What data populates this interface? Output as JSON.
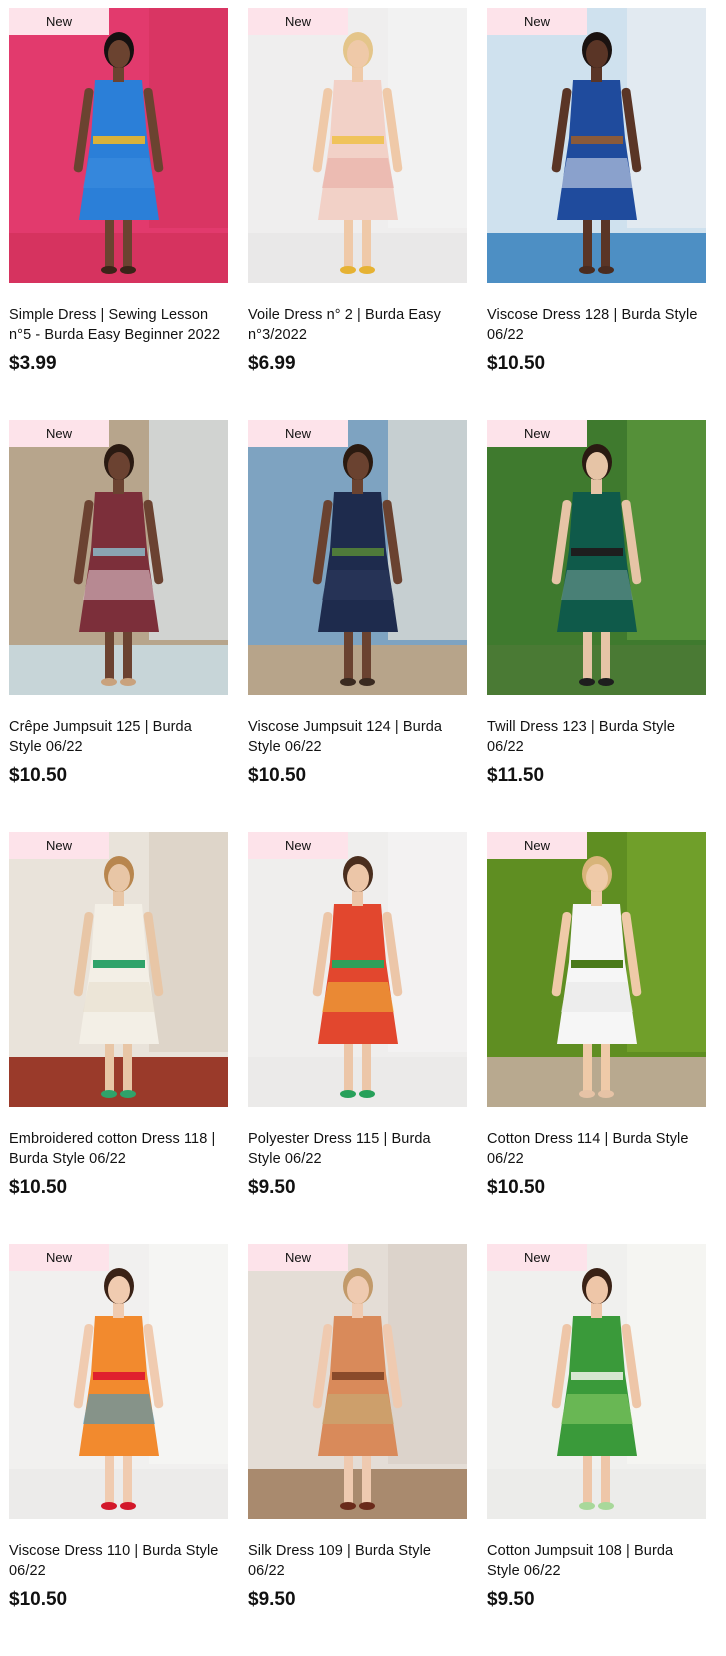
{
  "products": [
    {
      "badge": "New",
      "title": "Simple Dress | Sewing Lesson n°5 - Burda Easy Beginner 2022",
      "price": "$3.99",
      "scene": {
        "bg": "#e23a6d",
        "bg2": "#d6335f",
        "ground": "#d6335f",
        "dress": "#2b7fd8",
        "dress2": "#3e8ee0",
        "skin": "#6b4330",
        "hair": "#151010",
        "accent": "#d9b13a",
        "shoes": "#3a2418"
      }
    },
    {
      "badge": "New",
      "title": "Voile Dress n° 2 | Burda Easy n°3/2022",
      "price": "$6.99",
      "scene": {
        "bg": "#efeeee",
        "bg2": "#f4f3f3",
        "ground": "#e9e8e8",
        "dress": "#f2d1c7",
        "dress2": "#e7a9a1",
        "skin": "#efc9a8",
        "hair": "#e4c58a",
        "accent": "#f0c35b",
        "shoes": "#e6b233"
      }
    },
    {
      "badge": "New",
      "title": "Viscose Dress 128 | Burda Style 06/22",
      "price": "$10.50",
      "scene": {
        "bg": "#cfe1ee",
        "bg2": "#e9eef2",
        "ground": "#4d8fc4",
        "dress": "#1f4b9d",
        "dress2": "#e1e9f3",
        "skin": "#5a3526",
        "hair": "#1a1210",
        "accent": "#8a5a3a",
        "shoes": "#4a2c20"
      }
    },
    {
      "badge": "New",
      "title": "Crêpe Jumpsuit 125 | Burda Style 06/22",
      "price": "$10.50",
      "scene": {
        "bg": "#b7a58c",
        "bg2": "#dbe7ee",
        "ground": "#c7d5d8",
        "dress": "#7c2f3a",
        "dress2": "#e7d3da",
        "skin": "#6b4231",
        "hair": "#2a1a12",
        "accent": "#8aa4b2",
        "shoes": "#c9a27d"
      }
    },
    {
      "badge": "New",
      "title": "Viscose Jumpsuit 124 | Burda Style 06/22",
      "price": "$10.50",
      "scene": {
        "bg": "#7ea3c1",
        "bg2": "#e6e1d7",
        "ground": "#b7a48a",
        "dress": "#1e2b4d",
        "dress2": "#2e3b5e",
        "skin": "#6a4230",
        "hair": "#2b1a10",
        "accent": "#4f7a3a",
        "shoes": "#3a2a20"
      }
    },
    {
      "badge": "New",
      "title": "Twill Dress 123 | Burda Style 06/22",
      "price": "$11.50",
      "scene": {
        "bg": "#3f7a2e",
        "bg2": "#5f9a3e",
        "ground": "#4a7a34",
        "dress": "#0f5a4a",
        "dress2": "#7aa09a",
        "skin": "#e6c4a6",
        "hair": "#2a1a12",
        "accent": "#1e1e1e",
        "shoes": "#1e1e1e"
      }
    },
    {
      "badge": "New",
      "title": "Embroidered cotton Dress 118 | Burda Style 06/22",
      "price": "$10.50",
      "scene": {
        "bg": "#e9e3da",
        "bg2": "#d8cfc2",
        "ground": "#9a3a2a",
        "dress": "#f3efe6",
        "dress2": "#e6dccb",
        "skin": "#e8c6a6",
        "hair": "#b8864e",
        "accent": "#2fa36a",
        "shoes": "#2fa36a"
      }
    },
    {
      "badge": "New",
      "title": "Polyester Dress 115 | Burda Style 06/22",
      "price": "$9.50",
      "scene": {
        "bg": "#efeeed",
        "bg2": "#f5f4f3",
        "ground": "#ebeae9",
        "dress": "#e2472e",
        "dress2": "#f0c03a",
        "skin": "#ecc6a8",
        "hair": "#4a2e1e",
        "accent": "#2fa05a",
        "shoes": "#27a05a"
      }
    },
    {
      "badge": "New",
      "title": "Cotton Dress 114 | Burda Style 06/22",
      "price": "$10.50",
      "scene": {
        "bg": "#5f8e22",
        "bg2": "#78a62e",
        "ground": "#b8a98f",
        "dress": "#f6f6f6",
        "dress2": "#e6e6e6",
        "skin": "#efcaa8",
        "hair": "#d8b47a",
        "accent": "#4a7a1a",
        "shoes": "#e6c3a6"
      }
    },
    {
      "badge": "New",
      "title": "Viscose Dress 110 | Burda Style 06/22",
      "price": "$10.50",
      "scene": {
        "bg": "#f1f0ef",
        "bg2": "#f7f6f5",
        "ground": "#ecebea",
        "dress": "#f28a2e",
        "dress2": "#2e9ad6",
        "skin": "#f0cbb0",
        "hair": "#3a2216",
        "accent": "#e0202e",
        "shoes": "#d3182a"
      }
    },
    {
      "badge": "New",
      "title": "Silk Dress 109 | Burda Style 06/22",
      "price": "$9.50",
      "scene": {
        "bg": "#e4ddd6",
        "bg2": "#d9cfc6",
        "ground": "#a98a6e",
        "dress": "#d98a5a",
        "dress2": "#c2b07a",
        "skin": "#efcab0",
        "hair": "#c29a6a",
        "accent": "#8a4a2a",
        "shoes": "#6a2a1a"
      }
    },
    {
      "badge": "New",
      "title": "Cotton Jumpsuit 108 | Burda Style 06/22",
      "price": "$9.50",
      "scene": {
        "bg": "#f0f0ee",
        "bg2": "#f6f6f4",
        "ground": "#ececea",
        "dress": "#3a9a3a",
        "dress2": "#8fd06a",
        "skin": "#eec6a8",
        "hair": "#3a2216",
        "accent": "#d6e6d0",
        "shoes": "#a8d89a"
      }
    }
  ]
}
